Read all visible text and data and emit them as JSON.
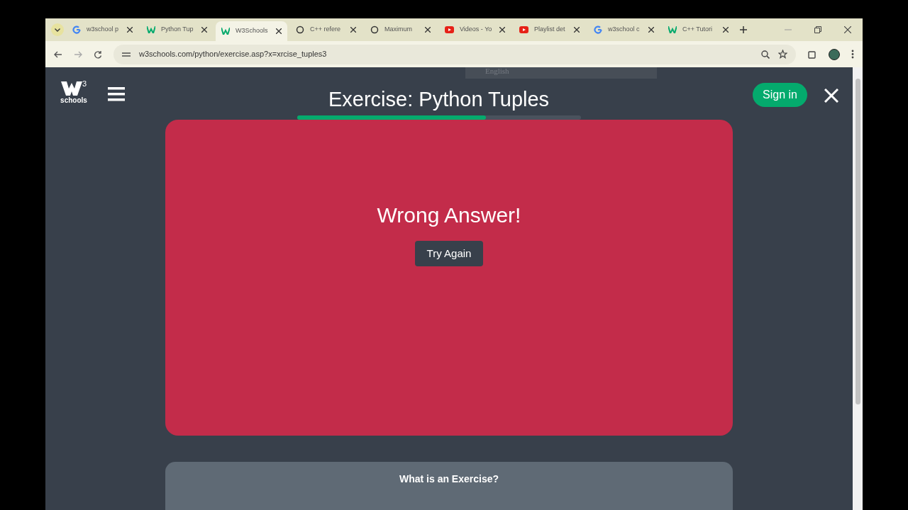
{
  "browser": {
    "tabs": [
      {
        "title": "w3school p",
        "kind": "google",
        "selected": false
      },
      {
        "title": "Python Tup",
        "kind": "w3",
        "selected": false
      },
      {
        "title": "W3Schools",
        "kind": "w3",
        "selected": true
      },
      {
        "title": "C++ refere",
        "kind": "openai",
        "selected": false
      },
      {
        "title": "Maximum",
        "kind": "openai",
        "selected": false
      },
      {
        "title": "Videos - Yo",
        "kind": "youtube",
        "selected": false
      },
      {
        "title": "Playlist det",
        "kind": "youtube",
        "selected": false
      },
      {
        "title": "w3school c",
        "kind": "google",
        "selected": false
      },
      {
        "title": "C++ Tutori",
        "kind": "w3",
        "selected": false
      }
    ],
    "url": "w3schools.com/python/exercise.asp?x=xrcise_tuples3",
    "translate_bar": {
      "language": "English"
    }
  },
  "header": {
    "logo_text": "schools",
    "logo_sup": "3",
    "title": "Exercise: Python Tuples",
    "progress": {
      "level": 0.665
    },
    "sign_in": "Sign in"
  },
  "result": {
    "message": "Wrong Answer!",
    "button": "Try Again"
  },
  "info": {
    "title": "What is an Exercise?"
  }
}
